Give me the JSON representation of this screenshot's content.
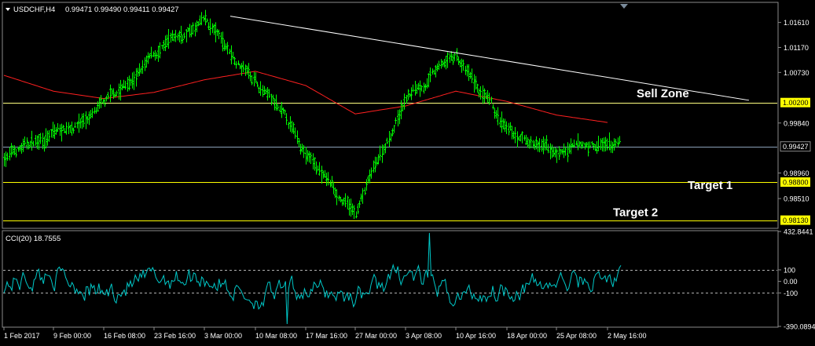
{
  "chart_data": {
    "type": "ohlc",
    "main": {
      "symbol_label": "USDCHF,H4",
      "ohlc_label": "0.99471 0.99490 0.99411 0.99427",
      "current_price": 0.99427,
      "ylim": [
        0.98,
        1.0195
      ],
      "y_ticks": [
        1.0161,
        1.0117,
        1.0073,
        0.9984,
        0.9896,
        0.9851
      ],
      "y_tick_labels": [
        "1.01610",
        "1.01170",
        "1.00730",
        "0.99840",
        "0.98960",
        "0.98510"
      ],
      "levels": [
        {
          "value": 1.002,
          "label": "1.00200",
          "color": "#ffff80"
        },
        {
          "value": 0.99427,
          "label": "0.99427",
          "color": "#8aa0b8"
        },
        {
          "value": 0.988,
          "label": "0.98800",
          "color": "#ffff00"
        },
        {
          "value": 0.9813,
          "label": "0.98130",
          "color": "#ffff00"
        }
      ],
      "annotations": [
        {
          "text": "Sell Zone",
          "x": "10 Apr 16:00",
          "y": 1.0029
        },
        {
          "text": "Target 1",
          "x": "25 Apr 08:00",
          "y": 0.9868
        },
        {
          "text": "Target 2",
          "x": "10 Apr 16:00",
          "y": 0.982
        }
      ],
      "trendline": {
        "from": {
          "x": "3 Mar 00:00",
          "y": 1.0172
        },
        "to": {
          "x": "2 May 16:00",
          "y": 1.0024
        },
        "color": "#ffffff"
      },
      "moving_average_color": "#ff2020",
      "moving_average_points": [
        {
          "x": "1 Feb 2017",
          "y": 1.0068
        },
        {
          "x": "9 Feb 00:00",
          "y": 1.004
        },
        {
          "x": "16 Feb 08:00",
          "y": 1.0027
        },
        {
          "x": "23 Feb 16:00",
          "y": 1.0038
        },
        {
          "x": "3 Mar 00:00",
          "y": 1.006
        },
        {
          "x": "10 Mar 08:00",
          "y": 1.0075
        },
        {
          "x": "17 Mar 16:00",
          "y": 1.005
        },
        {
          "x": "27 Mar 00:00",
          "y": 1.0
        },
        {
          "x": "3 Apr 08:00",
          "y": 1.0014
        },
        {
          "x": "10 Apr 16:00",
          "y": 1.004
        },
        {
          "x": "18 Apr 00:00",
          "y": 1.0022
        },
        {
          "x": "25 Apr 08:00",
          "y": 0.9998
        },
        {
          "x": "2 May 16:00",
          "y": 0.9985
        }
      ],
      "price_points": [
        {
          "x": "1 Feb 2017",
          "y": 0.9925
        },
        {
          "x": "9 Feb 00:00",
          "y": 0.9965
        },
        {
          "x": "16 Feb 08:00",
          "y": 1.001
        },
        {
          "x": "23 Feb 16:00",
          "y": 1.01
        },
        {
          "x": "3 Mar 00:00",
          "y": 1.016
        },
        {
          "x": "10 Mar 08:00",
          "y": 1.006
        },
        {
          "x": "17 Mar 16:00",
          "y": 0.993
        },
        {
          "x": "27 Mar 00:00",
          "y": 0.982
        },
        {
          "x": "3 Apr 08:00",
          "y": 1.003
        },
        {
          "x": "10 Apr 16:00",
          "y": 1.01
        },
        {
          "x": "18 Apr 00:00",
          "y": 0.996
        },
        {
          "x": "25 Apr 08:00",
          "y": 0.993
        },
        {
          "x": "2 May 16:00",
          "y": 0.9943
        }
      ],
      "bar_color": "#00ff00"
    },
    "indicator": {
      "label": "CCI(20) 18.7555",
      "ylim": [
        -390.0894,
        432.8441
      ],
      "y_ticks": [
        432.8441,
        100,
        0.0,
        -100,
        -390.0894
      ],
      "y_tick_labels": [
        "432.8441",
        "100",
        "0.00",
        "-100",
        "-390.0894"
      ],
      "dashed_levels": [
        100,
        -100
      ],
      "line_color": "#00c8c8",
      "points": [
        {
          "x": "1 Feb 2017",
          "y": -20
        },
        {
          "x": "9 Feb 00:00",
          "y": 60
        },
        {
          "x": "16 Feb 08:00",
          "y": -110
        },
        {
          "x": "23 Feb 16:00",
          "y": 30
        },
        {
          "x": "3 Mar 00:00",
          "y": 40
        },
        {
          "x": "10 Mar 08:00",
          "y": -150
        },
        {
          "x": "17 Mar 16:00",
          "y": -60
        },
        {
          "x": "27 Mar 00:00",
          "y": -130
        },
        {
          "x": "3 Apr 08:00",
          "y": 80
        },
        {
          "x": "10 Apr 16:00",
          "y": -140
        },
        {
          "x": "18 Apr 00:00",
          "y": -60
        },
        {
          "x": "25 Apr 08:00",
          "y": -20
        },
        {
          "x": "2 May 16:00",
          "y": 18.7555
        }
      ]
    },
    "x_categories": [
      "1 Feb 2017",
      "9 Feb 00:00",
      "16 Feb 08:00",
      "23 Feb 16:00",
      "3 Mar 00:00",
      "10 Mar 08:00",
      "17 Mar 16:00",
      "27 Mar 00:00",
      "3 Apr 08:00",
      "10 Apr 16:00",
      "18 Apr 00:00",
      "25 Apr 08:00",
      "2 May 16:00"
    ],
    "grid": false
  }
}
